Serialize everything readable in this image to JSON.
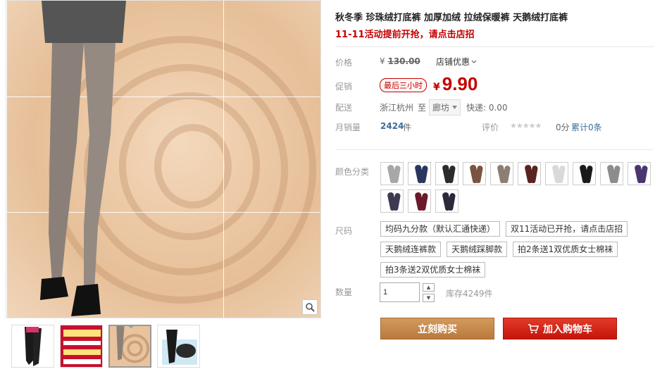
{
  "product": {
    "title": "秋冬季 珍珠绒打底裤 加厚加绒 拉绒保暖裤 天鹅绒打底裤",
    "promo_line": "11-11活动提前开抢，请点击店招"
  },
  "price": {
    "label": "价格",
    "currency_symbol": "¥",
    "original": "130.00",
    "store_discount": "店铺优惠"
  },
  "promotion": {
    "label": "促销",
    "tag": "最后三小时",
    "currency_symbol": "¥",
    "price": "9.90"
  },
  "shipping": {
    "label": "配送",
    "from": "浙江杭州",
    "to_word": "至",
    "destination": "廊坊",
    "fee": "快递: 0.00"
  },
  "sales": {
    "label": "月销量",
    "count": "2424",
    "unit": "件",
    "rating_label": "评价",
    "stars": "★★★★★",
    "score": "0分",
    "reviews": "累计0条"
  },
  "color": {
    "label": "颜色分类",
    "swatches": [
      {
        "name": "swatch-1",
        "color": "#a7a7a7"
      },
      {
        "name": "swatch-2",
        "color": "#2a3560"
      },
      {
        "name": "swatch-3",
        "color": "#2b2b2b"
      },
      {
        "name": "swatch-4",
        "color": "#7b5440"
      },
      {
        "name": "swatch-5",
        "color": "#8d7e74"
      },
      {
        "name": "swatch-6",
        "color": "#5a2420"
      },
      {
        "name": "swatch-7",
        "color": "#d9d9d9"
      },
      {
        "name": "swatch-8",
        "color": "#1a1a1a"
      },
      {
        "name": "swatch-9",
        "color": "#8c8c8c"
      },
      {
        "name": "swatch-10",
        "color": "#4a3570"
      },
      {
        "name": "swatch-11",
        "color": "#3c3a50"
      },
      {
        "name": "swatch-12",
        "color": "#6a1a2a"
      },
      {
        "name": "swatch-13",
        "color": "#2a2a3a"
      }
    ]
  },
  "size": {
    "label": "尺码",
    "options": [
      "均码九分款（默认汇通快递）",
      "双11活动已开抢，请点击店招",
      "天鹅绒连裤款",
      "天鹅绒踩脚款",
      "拍2条送1双优质女士棉袜",
      "拍3条送2双优质女士棉袜"
    ]
  },
  "quantity": {
    "label": "数量",
    "value": "1",
    "stock": "库存4249件"
  },
  "actions": {
    "buy_now": "立刻购买",
    "add_cart": "加入购物车"
  },
  "colors": {
    "accent_red": "#c40000",
    "buy_now_bg": "#c78a4a",
    "add_cart_bg": "#d42a1c",
    "link_blue": "#3c6d99"
  }
}
